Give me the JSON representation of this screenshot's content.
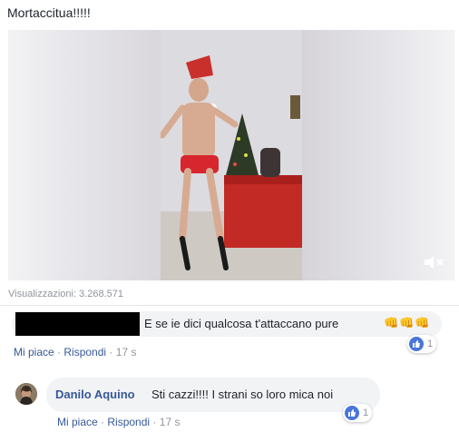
{
  "post": {
    "text": "Mortaccitua!!!!!",
    "views_label": "Visualizzazioni: 3.268.571"
  },
  "video": {
    "mute_icon": "speaker-mute-icon"
  },
  "comments": [
    {
      "author_redacted": true,
      "text": "E se ie dici qualcosa t'attaccano pure",
      "emojis": "👊👊👊",
      "reaction_count": "1",
      "like_label": "Mi piace",
      "reply_label": "Rispondi",
      "time": "17 s"
    },
    {
      "author": "Danilo Aquino",
      "text": "Sti cazzi!!!! I strani so loro mica noi",
      "reaction_count": "1",
      "like_label": "Mi piace",
      "reply_label": "Rispondi",
      "time": "17 s"
    }
  ],
  "colors": {
    "link": "#365899",
    "muted": "#90949c",
    "bubble": "#f2f3f5",
    "like_blue": "#4a76d8"
  }
}
